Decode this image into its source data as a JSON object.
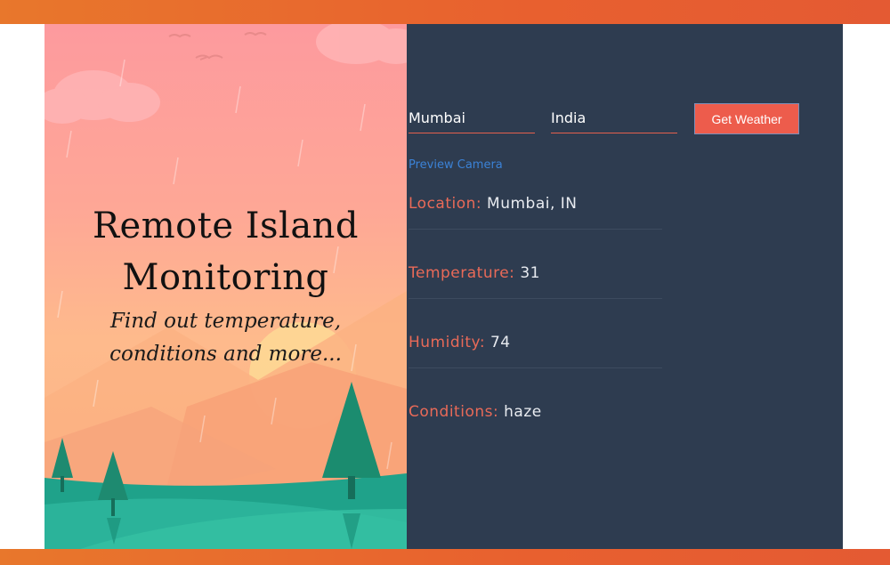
{
  "hero": {
    "title_line1": "Remote Island",
    "title_line2": "Monitoring",
    "subtitle_line1": "Find out temperature,",
    "subtitle_line2": "conditions and more..."
  },
  "form": {
    "city_value": "Mumbai",
    "country_value": "India",
    "submit_label": "Get Weather"
  },
  "preview_link": "Preview Camera",
  "weather": [
    {
      "label": "Location:",
      "value": "Mumbai, IN"
    },
    {
      "label": "Temperature:",
      "value": "31"
    },
    {
      "label": "Humidity:",
      "value": "74"
    },
    {
      "label": "Conditions:",
      "value": "haze"
    }
  ],
  "colors": {
    "accent": "#ed5c4c",
    "panel_dark": "#2e3c50",
    "link": "#3b82d6",
    "label": "#e96a58",
    "header_bar": "#e8602f"
  }
}
